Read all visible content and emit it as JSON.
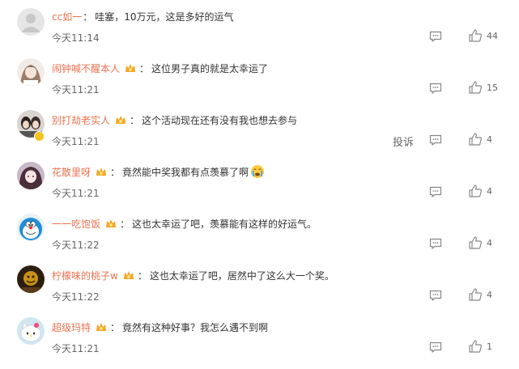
{
  "comments": [
    {
      "username": "cc如一",
      "badge": false,
      "text": "哇塞，10万元，这是多好的运气",
      "time": "今天11:14",
      "likes": "44",
      "avatar_icon": "default-avatar-icon"
    },
    {
      "username": "闹钟喊不醒本人",
      "badge": true,
      "text": "这位男子真的就是太幸运了",
      "time": "今天11:21",
      "likes": "15",
      "avatar_icon": "girl-avatar-icon"
    },
    {
      "username": "别打劫老实人",
      "badge": true,
      "verified": true,
      "text": "这个活动现在还有没有我也想去参与",
      "time": "今天11:21",
      "likes": "4",
      "report": "投诉",
      "avatar_icon": "couple-avatar-icon"
    },
    {
      "username": "花散里呀",
      "badge": true,
      "text": "竟然能中奖我都有点羡慕了啊",
      "emoji": "crying-face-icon",
      "time": "今天11:21",
      "likes": "4",
      "avatar_icon": "anime-girl-avatar-icon"
    },
    {
      "username": "一一吃饱饭",
      "badge": true,
      "text": "这也太幸运了吧，羡慕能有这样的好运气。",
      "time": "今天11:22",
      "likes": "4",
      "avatar_icon": "doraemon-avatar-icon"
    },
    {
      "username": "柠檬味的桃子w",
      "badge": true,
      "text": "这也太幸运了吧，居然中了这么大一个奖。",
      "time": "今天11:22",
      "likes": "4",
      "avatar_icon": "dark-avatar-icon"
    },
    {
      "username": "超级玛特",
      "badge": true,
      "text": "竟然有这种好事？我怎么遇不到啊",
      "time": "今天11:21",
      "likes": "1",
      "avatar_icon": "hello-kitty-avatar-icon"
    }
  ],
  "colors": {
    "username": "#eb7350",
    "text": "#333333",
    "meta": "#666666",
    "badge": "#f6a623"
  }
}
